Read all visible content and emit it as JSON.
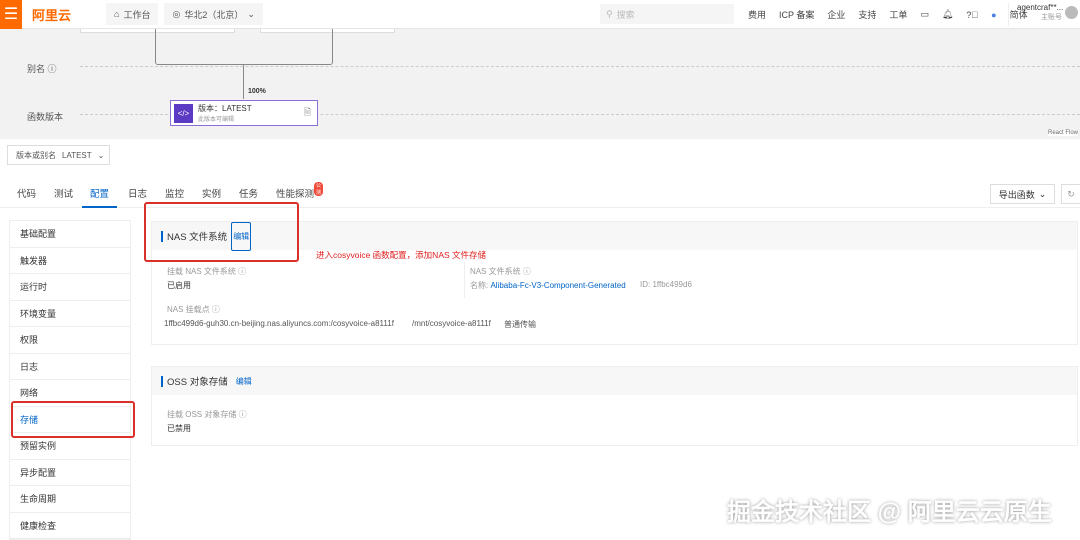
{
  "topbar": {
    "logo": "阿里云",
    "workbench": "工作台",
    "region": "华北2（北京）",
    "search_placeholder": "搜索",
    "nav": [
      "费用",
      "ICP 备案",
      "企业",
      "支持",
      "工单"
    ],
    "lang": "简体",
    "user": "agentcraf**...",
    "account_type": "主账号"
  },
  "flow": {
    "alias_label": "别名",
    "version_label": "函数版本",
    "percent": "100%",
    "node_title": "版本：LATEST",
    "node_sub": "此版本可编辑",
    "react_flow": "React Flow"
  },
  "version_select": {
    "label": "版本或别名",
    "value": "LATEST"
  },
  "tabs": [
    {
      "label": "代码"
    },
    {
      "label": "测试"
    },
    {
      "label": "配置"
    },
    {
      "label": "日志"
    },
    {
      "label": "监控"
    },
    {
      "label": "实例"
    },
    {
      "label": "任务"
    },
    {
      "label": "性能探测",
      "badge": "公测"
    }
  ],
  "export_button": "导出函数",
  "sidebar": [
    "基础配置",
    "触发器",
    "运行时",
    "环境变量",
    "权限",
    "日志",
    "网络",
    "存储",
    "预留实例",
    "异步配置",
    "生命周期",
    "健康检查"
  ],
  "nas": {
    "title": "NAS 文件系统",
    "edit": "编辑",
    "mount_label": "挂载 NAS 文件系统",
    "mount_value": "已启用",
    "fs_label": "NAS 文件系统",
    "name_prefix": "名称:",
    "name": "Alibaba-Fc-V3-Component-Generated",
    "id": "ID: 1ffbc499d6",
    "mount_point_label": "NAS 挂载点",
    "mount_point": "1ffbc499d6-guh30.cn-beijing.nas.aliyuncs.com:/cosyvoice-a8111f",
    "local_path": "/mnt/cosyvoice-a8111f",
    "transport": "普通传输"
  },
  "oss": {
    "title": "OSS 对象存储",
    "edit": "编辑",
    "mount_label": "挂载 OSS 对象存储",
    "mount_value": "已禁用"
  },
  "annotation": "进入cosyvoice 函数配置，添加NAS 文件存储",
  "watermark": "掘金技术社区 @ 阿里云云原生"
}
